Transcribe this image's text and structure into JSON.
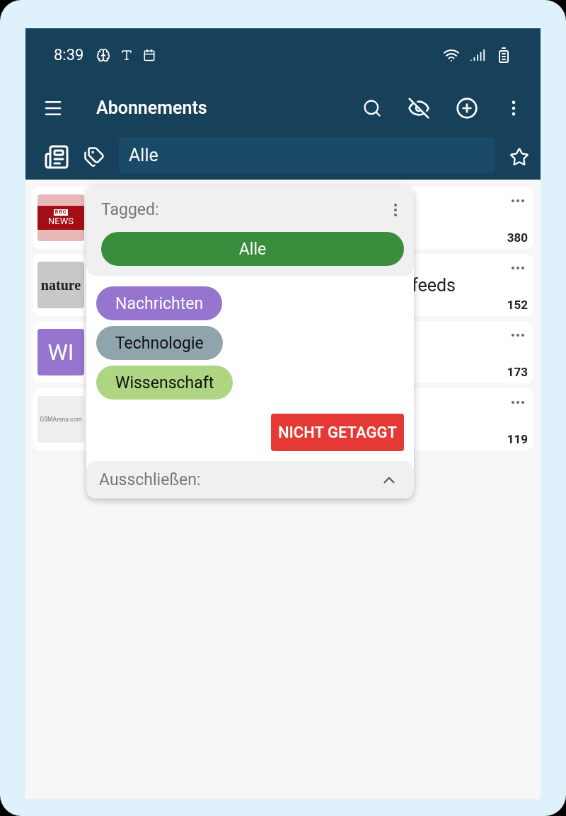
{
  "status_bar": {
    "time": "8:39"
  },
  "toolbar": {
    "title": "Abonnements"
  },
  "filter": {
    "value": "Alle"
  },
  "subscriptions": [
    {
      "kind": "bbc",
      "logo_top": "BBC",
      "logo_bottom": "NEWS",
      "count": "380"
    },
    {
      "kind": "nature",
      "logo": "nature",
      "title_visible": "feeds",
      "count": "152"
    },
    {
      "kind": "initials",
      "logo": "WI",
      "count": "173"
    },
    {
      "kind": "gsm",
      "logo": "GSMArena.com",
      "count": "119"
    }
  ],
  "tag_popup": {
    "heading": "Tagged:",
    "all_chip": {
      "label": "Alle",
      "selected": true
    },
    "tags": [
      {
        "label": "Nachrichten",
        "color": "#9575cd"
      },
      {
        "label": "Technologie",
        "color": "#90a4ae"
      },
      {
        "label": "Wissenschaft",
        "color": "#aed581"
      }
    ],
    "untagged_button": "NICHT GETAGGT",
    "exclude": {
      "label": "Ausschließen:",
      "expanded": true
    }
  }
}
